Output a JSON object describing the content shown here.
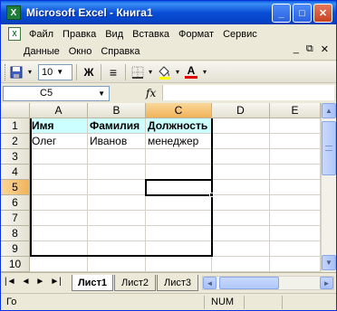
{
  "window": {
    "title": "Microsoft Excel - Книга1",
    "app_icon_letter": "X"
  },
  "title_buttons": {
    "minimize": "_",
    "maximize": "□",
    "close": "✕"
  },
  "menu": {
    "row1": [
      "Файл",
      "Правка",
      "Вид",
      "Вставка",
      "Формат",
      "Сервис"
    ],
    "row2": [
      "Данные",
      "Окно",
      "Справка"
    ],
    "mdi": {
      "minimize": "_",
      "restore": "⧉",
      "close": "✕"
    }
  },
  "toolbar": {
    "font_size": "10",
    "bold": "Ж",
    "align": "≡",
    "borders_icon": "borders-icon",
    "fill_icon": "fill-color-icon",
    "font_color_label": "A",
    "font_color": "#e00000"
  },
  "formula_bar": {
    "name_box": "C5",
    "fx_label": "fx",
    "value": ""
  },
  "columns": [
    "A",
    "B",
    "C",
    "D",
    "E"
  ],
  "rows": [
    "1",
    "2",
    "3",
    "4",
    "5",
    "6",
    "7",
    "8",
    "9",
    "10"
  ],
  "active_cell": {
    "col": "C",
    "row": "5"
  },
  "cells": {
    "A1": "Имя",
    "B1": "Фамилия",
    "C1": "Должность",
    "A2": "Олег",
    "B2": "Иванов",
    "C2": "менеджер"
  },
  "header_fill_color": "#ccffff",
  "sheet_tabs": [
    "Лист1",
    "Лист2",
    "Лист3"
  ],
  "active_sheet": "Лист1",
  "status": {
    "mode": "Го",
    "num": "NUM"
  }
}
